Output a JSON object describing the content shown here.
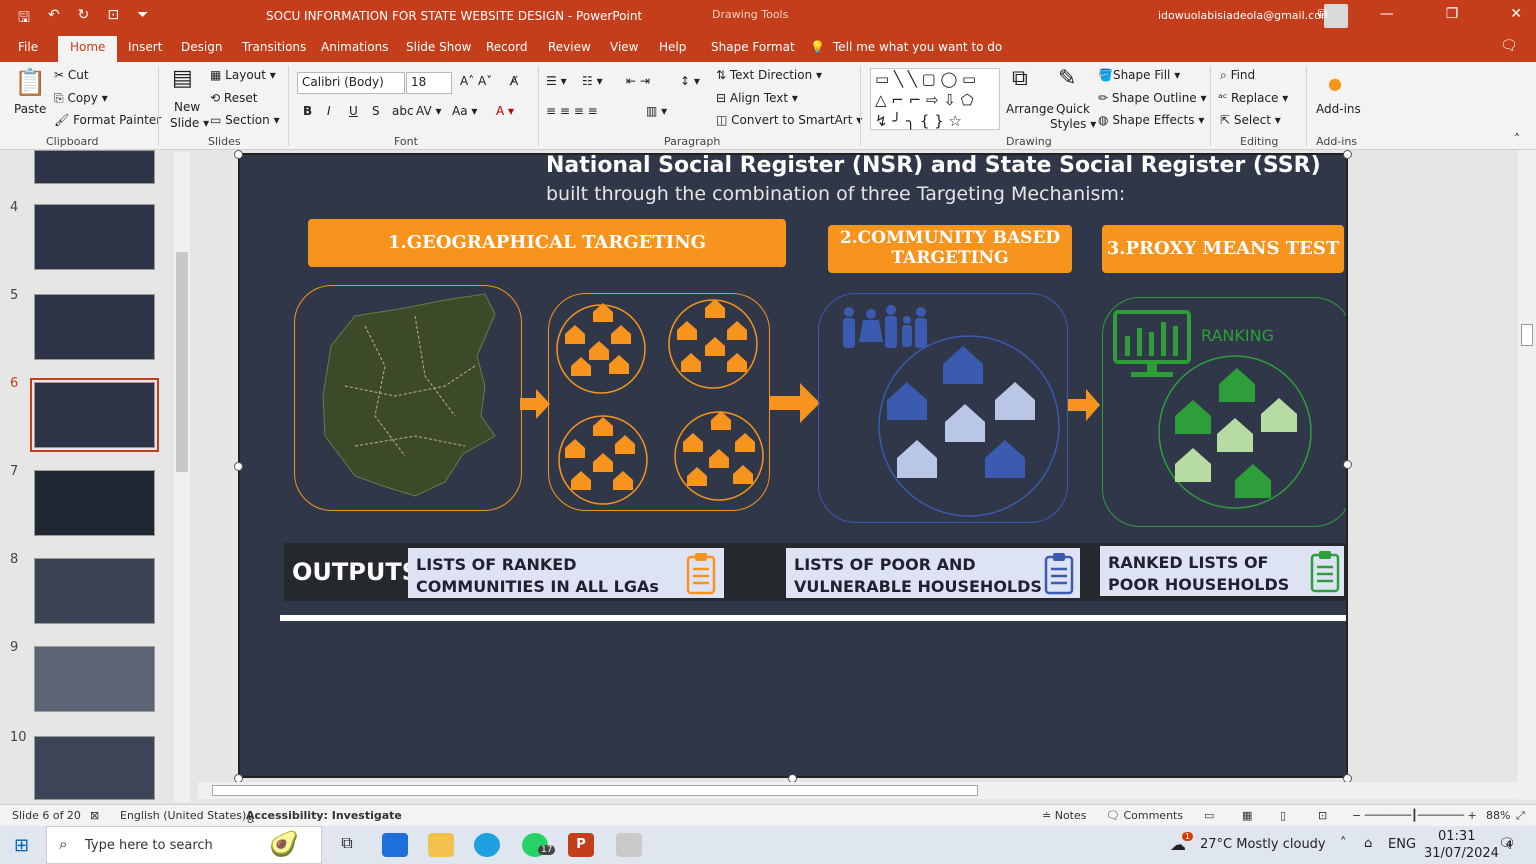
{
  "window": {
    "title": "SOCU INFORMATION FOR STATE WEBSITE DESIGN  -  PowerPoint",
    "context_label": "Drawing Tools",
    "account_email": "idowuolabisiadeola@gmail.com"
  },
  "tabs": [
    "File",
    "Home",
    "Insert",
    "Design",
    "Transitions",
    "Animations",
    "Slide Show",
    "Record",
    "Review",
    "View",
    "Help",
    "Shape Format"
  ],
  "tell_me": "Tell me what you want to do",
  "ribbon": {
    "clipboard": {
      "paste": "Paste",
      "cut": "Cut",
      "copy": "Copy",
      "format_painter": "Format Painter",
      "label": "Clipboard"
    },
    "slides": {
      "new_slide_1": "New",
      "new_slide_2": "Slide",
      "layout": "Layout",
      "reset": "Reset",
      "section": "Section",
      "label": "Slides"
    },
    "font": {
      "name": "Calibri (Body)",
      "size": "18",
      "label": "Font"
    },
    "paragraph": {
      "text_direction": "Text Direction",
      "align_text": "Align Text",
      "convert_smartart": "Convert to SmartArt",
      "label": "Paragraph"
    },
    "drawing": {
      "arrange": "Arrange",
      "quick_styles_1": "Quick",
      "quick_styles_2": "Styles",
      "shape_fill": "Shape Fill",
      "shape_outline": "Shape Outline",
      "shape_effects": "Shape Effects",
      "label": "Drawing"
    },
    "editing": {
      "find": "Find",
      "replace": "Replace",
      "select": "Select",
      "label": "Editing"
    },
    "addins": {
      "addins": "Add-ins",
      "label": "Add-ins"
    }
  },
  "thumbnails": [
    {
      "num": "4"
    },
    {
      "num": "5"
    },
    {
      "num": "6"
    },
    {
      "num": "7"
    },
    {
      "num": "8"
    },
    {
      "num": "9"
    },
    {
      "num": "10"
    }
  ],
  "slide": {
    "title": "National Social Register (NSR) and State Social Register (SSR)",
    "subtitle": "built through the combination of three Targeting Mechanism:",
    "box1": "1.GEOGRAPHICAL TARGETING",
    "box2_line1": "2.COMMUNITY BASED",
    "box2_line2": "TARGETING",
    "box3": "3.PROXY MEANS TEST",
    "ranking": "RANKING",
    "outputs_label": "OUTPUTS",
    "out1_line1": "LISTS OF RANKED",
    "out1_line2": "COMMUNITIES IN ALL LGAs",
    "out2_line1": "LISTS OF POOR AND",
    "out2_line2": "VULNERABLE HOUSEHOLDS",
    "out3_line1": "RANKED LISTS OF",
    "out3_line2": "POOR HOUSEHOLDS",
    "colors": {
      "orange": "#f7941d",
      "blue": "#3a5bb0",
      "green": "#2e9e3a",
      "bg": "#2f3748"
    }
  },
  "status": {
    "slide_of": "Slide 6 of 20",
    "language": "English (United States)",
    "accessibility": "Accessibility: Investigate",
    "notes": "Notes",
    "comments": "Comments",
    "zoom": "88%"
  },
  "taskbar": {
    "search_placeholder": "Type here to search",
    "whatsapp_badge": "17",
    "weather_badge": "1",
    "weather": "27°C  Mostly cloudy",
    "lang": "ENG",
    "time": "01:31",
    "date": "31/07/2024",
    "notif": "4"
  }
}
